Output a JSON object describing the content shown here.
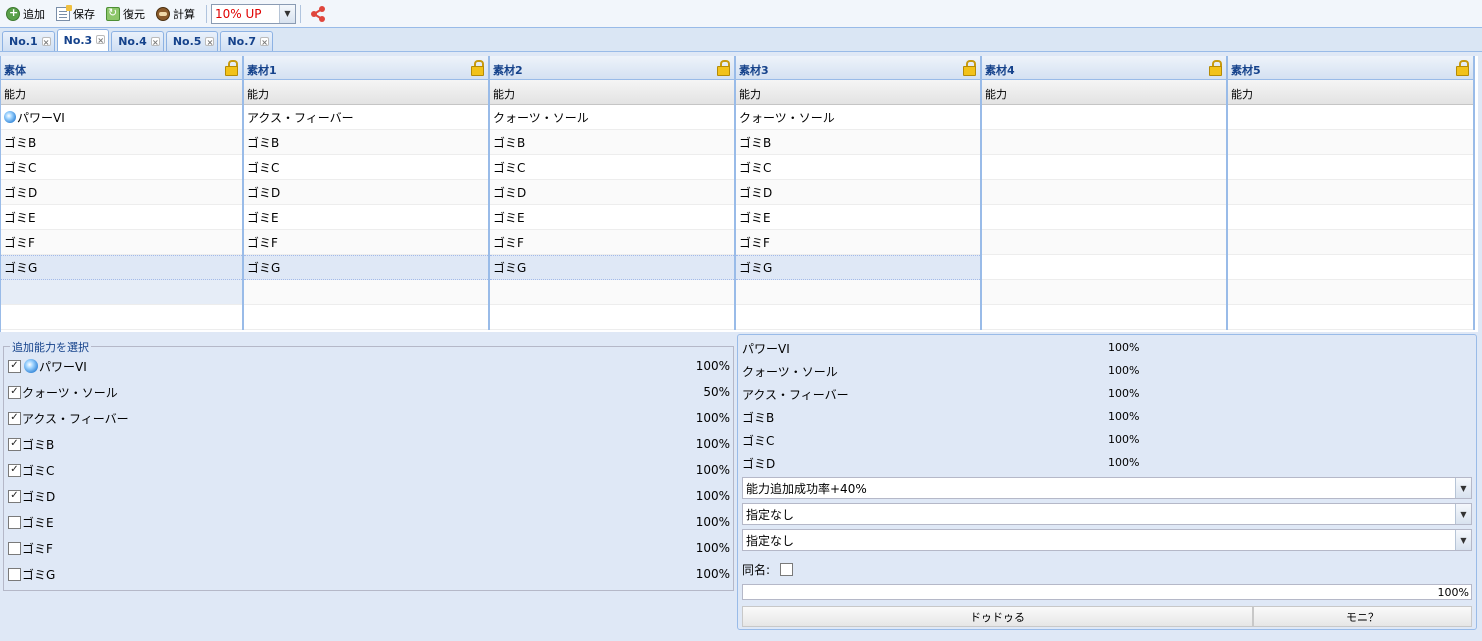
{
  "toolbar": {
    "add_label": "追加",
    "save_label": "保存",
    "restore_label": "復元",
    "calc_label": "計算",
    "boost_value": "10% UP"
  },
  "tabs": [
    {
      "label": "No.1"
    },
    {
      "label": "No.3"
    },
    {
      "label": "No.4"
    },
    {
      "label": "No.5"
    },
    {
      "label": "No.7"
    }
  ],
  "grid": {
    "columns": [
      {
        "header": "素体",
        "sub": "能力",
        "rows": [
          "パワーVI",
          "ゴミB",
          "ゴミC",
          "ゴミD",
          "ゴミE",
          "ゴミF",
          "ゴミG"
        ]
      },
      {
        "header": "素材1",
        "sub": "能力",
        "rows": [
          "アクス・フィーバー",
          "ゴミB",
          "ゴミC",
          "ゴミD",
          "ゴミE",
          "ゴミF",
          "ゴミG"
        ]
      },
      {
        "header": "素材2",
        "sub": "能力",
        "rows": [
          "クォーツ・ソール",
          "ゴミB",
          "ゴミC",
          "ゴミD",
          "ゴミE",
          "ゴミF",
          "ゴミG"
        ]
      },
      {
        "header": "素材3",
        "sub": "能力",
        "rows": [
          "クォーツ・ソール",
          "ゴミB",
          "ゴミC",
          "ゴミD",
          "ゴミE",
          "ゴミF",
          "ゴミG"
        ]
      },
      {
        "header": "素材4",
        "sub": "能力",
        "rows": []
      },
      {
        "header": "素材5",
        "sub": "能力",
        "rows": []
      }
    ]
  },
  "ability_select": {
    "legend": "追加能力を選択",
    "items": [
      {
        "label": "パワーVI",
        "pct": "100%",
        "checked": true
      },
      {
        "label": "クォーツ・ソール",
        "pct": "50%",
        "checked": true
      },
      {
        "label": "アクス・フィーバー",
        "pct": "100%",
        "checked": true
      },
      {
        "label": "ゴミB",
        "pct": "100%",
        "checked": true
      },
      {
        "label": "ゴミC",
        "pct": "100%",
        "checked": true
      },
      {
        "label": "ゴミD",
        "pct": "100%",
        "checked": true
      },
      {
        "label": "ゴミE",
        "pct": "100%",
        "checked": false
      },
      {
        "label": "ゴミF",
        "pct": "100%",
        "checked": false
      },
      {
        "label": "ゴミG",
        "pct": "100%",
        "checked": false
      }
    ]
  },
  "result": {
    "rows": [
      {
        "name": "パワーVI",
        "pct": "100%"
      },
      {
        "name": "クォーツ・ソール",
        "pct": "100%"
      },
      {
        "name": "アクス・フィーバー",
        "pct": "100%"
      },
      {
        "name": "ゴミB",
        "pct": "100%"
      },
      {
        "name": "ゴミC",
        "pct": "100%"
      },
      {
        "name": "ゴミD",
        "pct": "100%"
      }
    ],
    "combo1": "能力追加成功率+40%",
    "combo2": "指定なし",
    "combo3": "指定なし",
    "same_name_label": "同名:",
    "progress_text": "100%",
    "progress_value": 1.0,
    "button1": "ドゥドゥる",
    "button2": "モニ？"
  },
  "colors": {
    "accent": "#99bbe8",
    "header_text": "#15428b",
    "boost_text": "#e00000",
    "share": "#e0463c"
  }
}
